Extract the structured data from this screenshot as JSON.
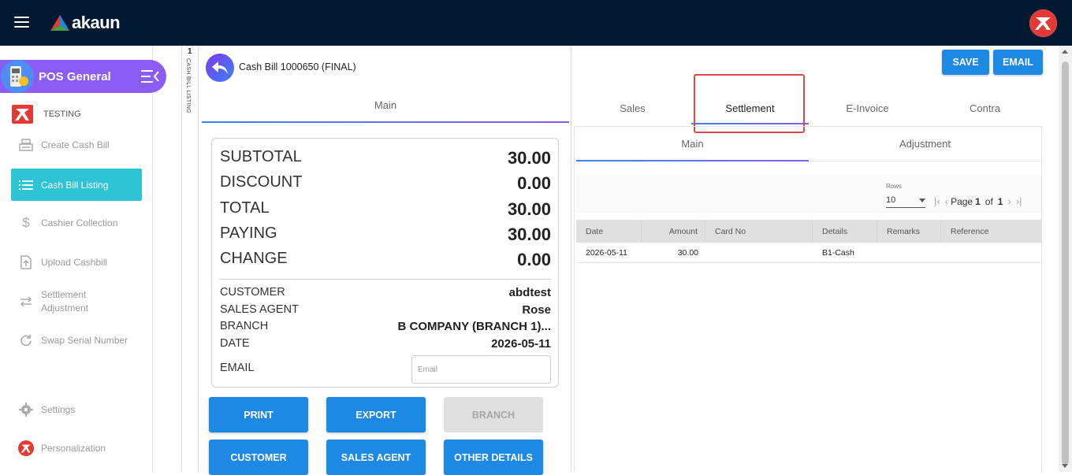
{
  "topbar": {
    "brand": "akaun",
    "menu_icon": "hamburger-icon",
    "user_icon": "company-logo-icon"
  },
  "sidebar": {
    "app_title": "POS General",
    "org_name": "TESTING",
    "items": [
      {
        "label": "Create Cash Bill",
        "icon": "cash-register-icon"
      },
      {
        "label": "Cash Bill Listing",
        "icon": "list-icon",
        "active": true
      },
      {
        "label": "Cashier Collection",
        "icon": "dollar-icon"
      },
      {
        "label": "Upload Cashbill",
        "icon": "upload-icon"
      },
      {
        "label": "Settlement Adjustment",
        "icon": "swap-arrows-icon"
      },
      {
        "label": "Swap Serial Number",
        "icon": "refresh-icon"
      },
      {
        "label": "Settings",
        "icon": "gear-icon"
      },
      {
        "label": "Personalization",
        "icon": "personalization-logo-icon"
      }
    ],
    "settlement_line1": "Settlement",
    "settlement_line2": "Adjustment"
  },
  "strip": {
    "count": "1",
    "label": "CASH BILL LISTING"
  },
  "bill": {
    "title": "Cash Bill 1000650 (FINAL)",
    "tab": "Main",
    "summary": {
      "subtotal_label": "SUBTOTAL",
      "subtotal": "30.00",
      "discount_label": "DISCOUNT",
      "discount": "0.00",
      "total_label": "TOTAL",
      "total": "30.00",
      "paying_label": "PAYING",
      "paying": "30.00",
      "change_label": "CHANGE",
      "change": "0.00"
    },
    "details": {
      "customer_label": "CUSTOMER",
      "customer": "abdtest",
      "agent_label": "SALES AGENT",
      "agent": "Rose",
      "branch_label": "BRANCH",
      "branch": "B COMPANY (BRANCH 1)...",
      "date_label": "DATE",
      "date": "2026-05-11",
      "email_label": "EMAIL",
      "email_placeholder": "Email"
    },
    "buttons": {
      "print": "PRINT",
      "export": "EXPORT",
      "branch": "BRANCH",
      "customer": "CUSTOMER",
      "sales_agent": "SALES AGENT",
      "other_details": "OTHER DETAILS"
    }
  },
  "right": {
    "save": "SAVE",
    "email": "EMAIL",
    "tabs": [
      "Sales",
      "Settlement",
      "E-Invoice",
      "Contra"
    ],
    "active_tab": "Settlement",
    "subtabs": [
      "Main",
      "Adjustment"
    ],
    "pager": {
      "rows_label": "Rows",
      "rows_value": "10",
      "page_label": "Page",
      "page": "1",
      "of_label": "of",
      "total_pages": "1"
    },
    "table": {
      "headers": [
        "Date",
        "Amount",
        "Card No",
        "Details",
        "Remarks",
        "Reference"
      ],
      "rows": [
        [
          "2026-05-11",
          "30.00",
          "",
          "B1-Cash",
          "",
          ""
        ]
      ]
    }
  },
  "colors": {
    "topbar": "#021a31",
    "accent_purple": "#8b5cf6",
    "active_cyan": "#2ec4d6",
    "button_blue": "#1e88e5",
    "highlight_red": "#e04848"
  }
}
